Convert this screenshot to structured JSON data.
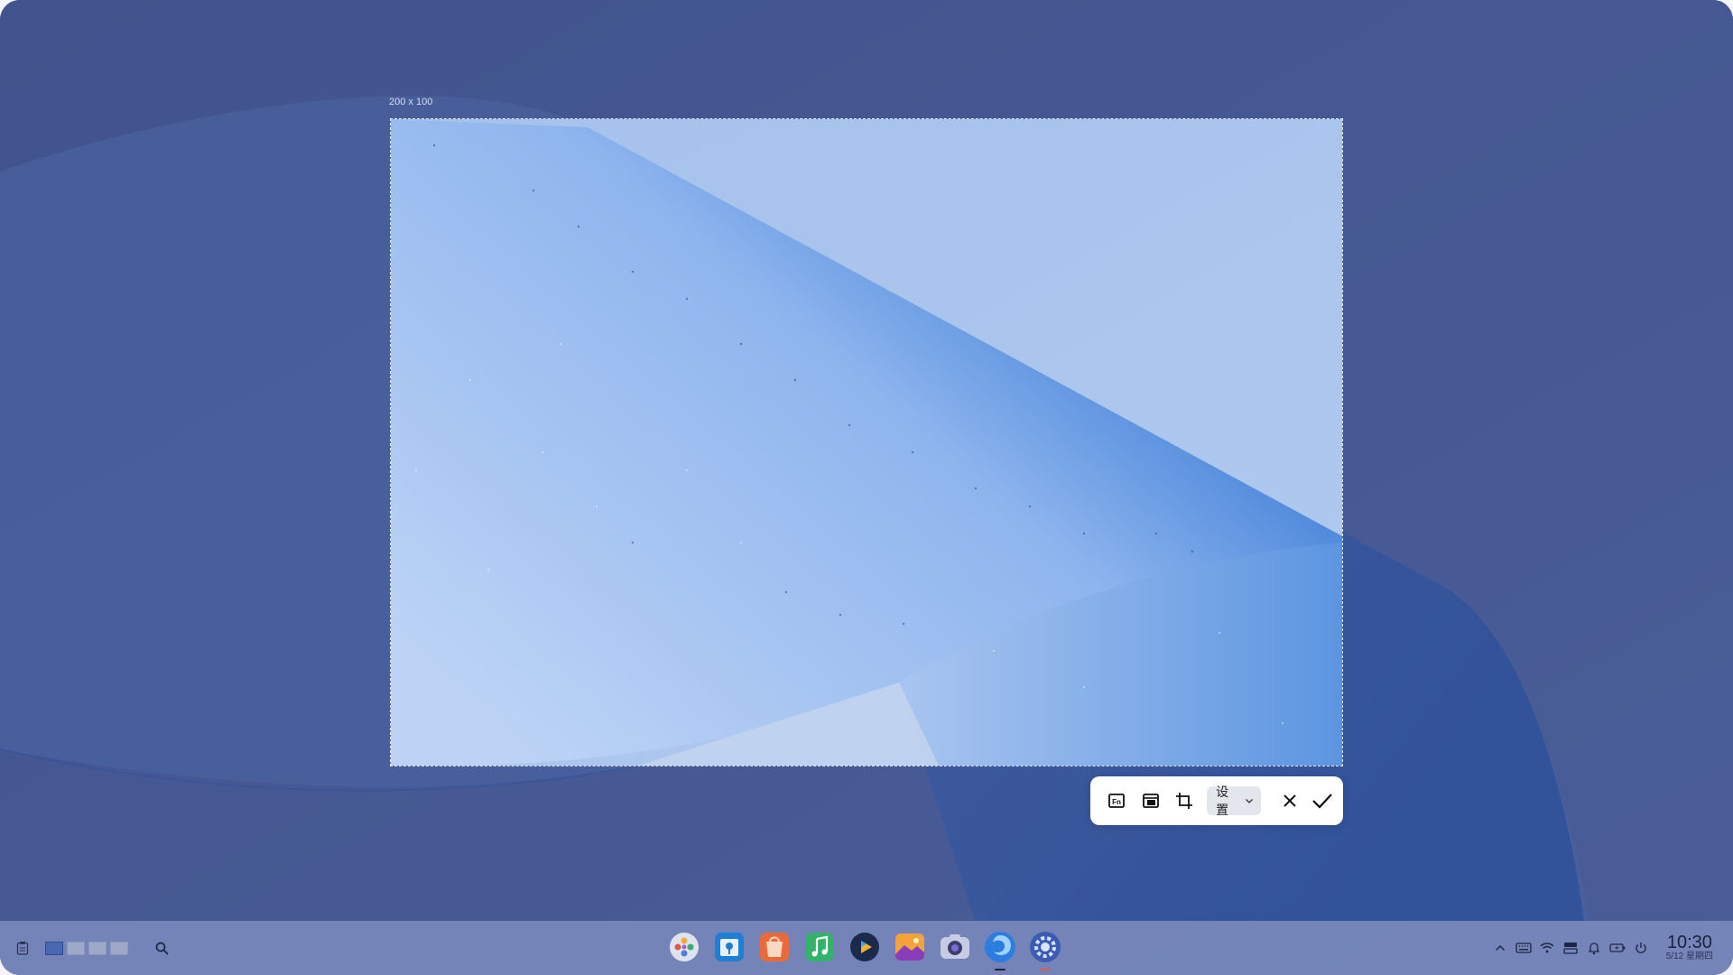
{
  "capture": {
    "size_label": "200 x 100",
    "settings_label": "设置"
  },
  "toolbar": {
    "tools": [
      "fullscreen-capture-icon",
      "window-capture-icon",
      "region-capture-icon"
    ],
    "cancel_icon": "close-icon",
    "confirm_icon": "check-icon"
  },
  "taskbar": {
    "workspaces": 4,
    "apps": [
      "launcher-icon",
      "app-store-icon",
      "shop-icon",
      "music-icon",
      "video-player-icon",
      "photos-icon",
      "camera-icon",
      "browser-icon",
      "settings-icon"
    ],
    "clock": {
      "time": "10:30",
      "date": "5/12 星期四"
    }
  },
  "colors": {
    "wallpaper_base": "#5a6ca3",
    "selection_fill": "#a6c1ea",
    "accent_blue": "#3c7fd9",
    "taskbar": "#7d8cbe"
  }
}
